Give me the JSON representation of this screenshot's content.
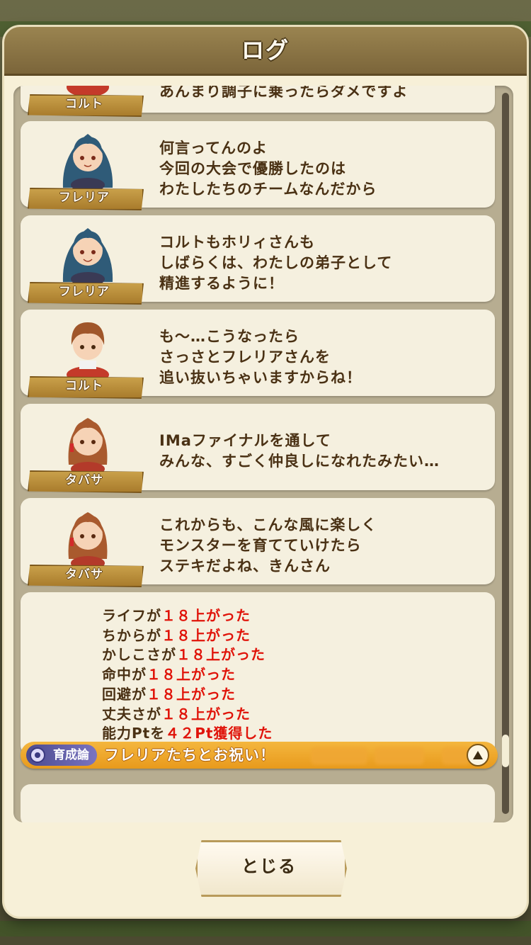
{
  "header": {
    "title": "ログ"
  },
  "log": [
    {
      "speaker": "コルト",
      "character": "colt",
      "lines": [
        "あんまり調子に乗ったらダメですよ"
      ]
    },
    {
      "speaker": "フレリア",
      "character": "fleria",
      "lines": [
        "何言ってんのよ",
        "今回の大会で優勝したのは",
        "わたしたちのチームなんだから"
      ]
    },
    {
      "speaker": "フレリア",
      "character": "fleria",
      "lines": [
        "コルトもホリィさんも",
        "しばらくは、わたしの弟子として",
        "精進するように！"
      ]
    },
    {
      "speaker": "コルト",
      "character": "colt",
      "lines": [
        "も～…こうなったら",
        "さっさとフレリアさんを",
        "追い抜いちゃいますからね！"
      ]
    },
    {
      "speaker": "タバサ",
      "character": "tabasa",
      "lines": [
        "IMaファイナルを通して",
        "みんな、すごく仲良しになれたみたい…"
      ]
    },
    {
      "speaker": "タバサ",
      "character": "tabasa",
      "lines": [
        "これからも、こんな風に楽しく",
        "モンスターを育てていけたら",
        "ステキだよね、きんさん"
      ]
    }
  ],
  "stats": [
    {
      "label": "ライフが",
      "value": "１８上がった"
    },
    {
      "label": "ちからが",
      "value": "１８上がった"
    },
    {
      "label": "かしこさが",
      "value": "１８上がった"
    },
    {
      "label": "命中が",
      "value": "１８上がった"
    },
    {
      "label": "回避が",
      "value": "１８上がった"
    },
    {
      "label": "丈夫さが",
      "value": "１８上がった"
    },
    {
      "label": "能力Ptを",
      "value": "４２Pt獲得した"
    }
  ],
  "event": {
    "badge": "育成論",
    "title": "フレリアたちとお祝い！",
    "toggle_icon": "chevron-up-icon"
  },
  "footer": {
    "close_label": "とじる"
  },
  "colors": {
    "text_brown": "#4a3114",
    "stat_red": "#e0140a",
    "event_orange": "#e89a1c",
    "header_brown": "#8a7445"
  }
}
